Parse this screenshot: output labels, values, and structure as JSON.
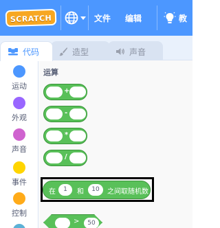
{
  "menu": {
    "logo": "SCRATCH",
    "file": "文件",
    "edit": "编辑",
    "cutoff": "教"
  },
  "tabs": {
    "code": "代码",
    "costumes": "造型",
    "sounds": "声音"
  },
  "categories": [
    {
      "label": "运动",
      "color": "#4c97ff"
    },
    {
      "label": "外观",
      "color": "#9966ff"
    },
    {
      "label": "声音",
      "color": "#cf63cf"
    },
    {
      "label": "事件",
      "color": "#ffd500"
    },
    {
      "label": "控制",
      "color": "#ffab19"
    }
  ],
  "palette": {
    "section_title": "运算",
    "operator_blocks": [
      "+",
      "-",
      "*",
      "/"
    ],
    "random_block": {
      "prefix": "在",
      "from": "1",
      "and": "和",
      "to": "10",
      "suffix": "之间取随机数"
    },
    "compare_block": {
      "op": ">",
      "value": "50"
    }
  },
  "colors": {
    "menubar": "#4c97ff",
    "operators": "#59c059",
    "operators_border": "#389438"
  }
}
